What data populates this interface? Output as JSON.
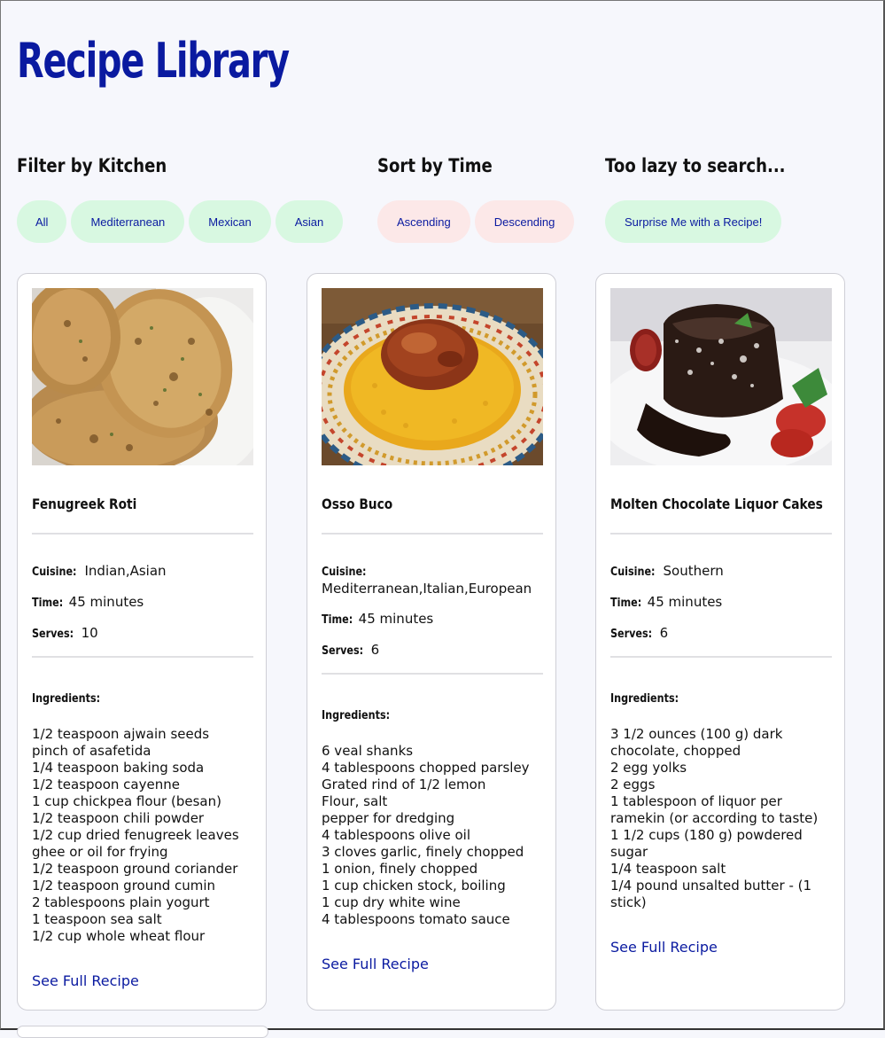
{
  "page": {
    "title": "Recipe Library"
  },
  "filter": {
    "heading": "Filter by Kitchen",
    "options": [
      "All",
      "Mediterranean",
      "Mexican",
      "Asian"
    ]
  },
  "sort": {
    "heading": "Sort by Time",
    "options": [
      "Ascending",
      "Descending"
    ]
  },
  "random": {
    "heading": "Too lazy to search...",
    "button": "Surprise Me with a Recipe!"
  },
  "labels": {
    "cuisine": "Cuisine:",
    "time": "Time:",
    "serves": "Serves:",
    "ingredients": "Ingredients:",
    "link": "See Full Recipe"
  },
  "recipes": [
    {
      "title": "Fenugreek Roti",
      "cuisine": "Indian,Asian",
      "time": "45 minutes",
      "serves": "10",
      "image_icon": "flatbread-photo",
      "ingredients": [
        "1/2 teaspoon ajwain seeds",
        "pinch of asafetida",
        "1/4 teaspoon baking soda",
        "1/2 teaspoon cayenne",
        "1 cup chickpea flour (besan)",
        "1/2 teaspoon chili powder",
        "1/2 cup dried fenugreek leaves",
        "ghee or oil for frying",
        "1/2 teaspoon ground coriander",
        "1/2 teaspoon ground cumin",
        "2 tablespoons plain yogurt",
        "1 teaspoon sea salt",
        "1/2 cup whole wheat flour"
      ]
    },
    {
      "title": "Osso Buco",
      "cuisine": "Mediterranean,Italian,European",
      "time": "45 minutes",
      "serves": "6",
      "image_icon": "braised-veal-photo",
      "ingredients": [
        "6 veal shanks",
        "4 tablespoons chopped parsley",
        "Grated rind of 1/2 lemon",
        "Flour, salt",
        "pepper for dredging",
        "4 tablespoons olive oil",
        "3 cloves garlic, finely chopped",
        "1 onion, finely chopped",
        "1 cup chicken stock, boiling",
        "1 cup dry white wine",
        "4 tablespoons tomato sauce"
      ]
    },
    {
      "title": "Molten Chocolate Liquor Cakes",
      "cuisine": "Southern",
      "time": "45 minutes",
      "serves": "6",
      "image_icon": "chocolate-cake-photo",
      "ingredients": [
        "3 1/2 ounces (100 g) dark chocolate, chopped",
        "2 egg yolks",
        "2 eggs",
        "1 tablespoon of liquor per ramekin (or according to taste)",
        "1 1/2 cups (180 g) powdered sugar",
        "1/4 teaspoon salt",
        "1/4 pound unsalted butter - (1 stick)"
      ]
    }
  ]
}
